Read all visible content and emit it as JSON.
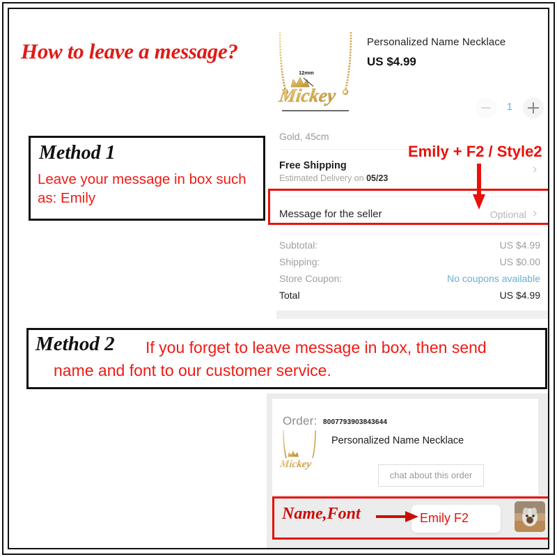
{
  "headline": "How to leave a message?",
  "methods": [
    {
      "label": "Method 1",
      "text": "Leave your message in box such as: Emily"
    },
    {
      "label": "Method 2",
      "text_line1": "If you forget to leave message in box, then send",
      "text_line2": "name and font to our customer service."
    }
  ],
  "order_panel": {
    "product_title": "Personalized Name Necklace",
    "price": "US $4.99",
    "quantity": "1",
    "qty_minus_icon": "minus-icon",
    "qty_plus_icon": "plus-icon",
    "variant": "Gold, 45cm",
    "shipping_title": "Free Shipping",
    "shipping_estimate_prefix": "Estimated Delivery on ",
    "shipping_estimate_date": "05/23",
    "message_label": "Message for the seller",
    "message_value": "Optional",
    "chevron_icon": "chevron-right-icon",
    "necklace_name": "Mickey",
    "necklace_dimension": "12mm",
    "totals": [
      {
        "key": "Subtotal:",
        "value": "US $4.99",
        "link": false,
        "emphasis": false
      },
      {
        "key": "Shipping:",
        "value": "US $0.00",
        "link": false,
        "emphasis": false
      },
      {
        "key": "Store Coupon:",
        "value": "No coupons available",
        "link": true,
        "emphasis": false
      },
      {
        "key": "Total",
        "value": "US $4.99",
        "link": false,
        "emphasis": true
      }
    ]
  },
  "annotations": {
    "emily_style": "Emily + F2 / Style2",
    "name_font": "Name,Font",
    "chat_message": "Emily F2",
    "arrow_down_icon": "red-arrow-down-icon",
    "arrow_right_icon": "red-arrow-right-icon"
  },
  "chat_panel": {
    "order_label": "Order:",
    "order_number": "8007793903843644",
    "product_title": "Personalized Name Necklace",
    "chat_button": "chat about this order",
    "necklace_name": "Mickey",
    "avatar_icon": "user-avatar-photo"
  },
  "colors": {
    "red": "#e8110a",
    "dark_red": "#cc0c07",
    "link_blue": "#69afd4",
    "qty_blue": "#6ab0d8",
    "gold": "#d8b15a",
    "panel_gray": "#ececec"
  }
}
